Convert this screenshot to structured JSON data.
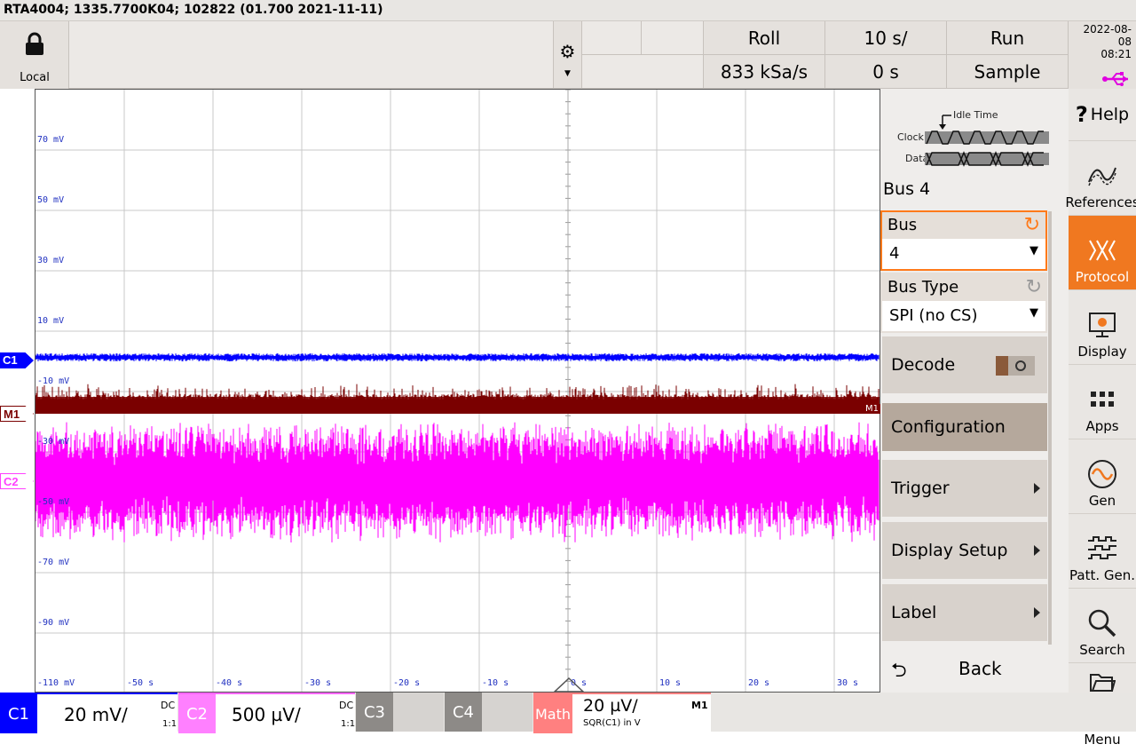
{
  "title_bar": "RTA4004; 1335.7700K04; 102822 (01.700 2021-11-11)",
  "header": {
    "lock_label": "Local",
    "acq_mode": "Roll",
    "timebase": "10 s/",
    "run_state": "Run",
    "sample_rate": "833 kSa/s",
    "offset": "0 s",
    "acq_type": "Sample",
    "date": "2022-08-08",
    "time": "08:21"
  },
  "plot": {
    "y_labels": [
      "70 mV",
      "50 mV",
      "30 mV",
      "10 mV",
      "-10 mV",
      "-30 mV",
      "-50 mV",
      "-70 mV",
      "-90 mV",
      "-110 mV"
    ],
    "x_labels": [
      "-50 s",
      "-40 s",
      "-30 s",
      "-20 s",
      "-10 s",
      "0 s",
      "10 s",
      "20 s",
      "30 s"
    ],
    "markers": {
      "c1": "C1",
      "m1": "M1",
      "c2": "C2",
      "m1_right": "M1"
    },
    "colors": {
      "c1": "#0000ff",
      "m1": "#7a0000",
      "c2": "#ff00ff"
    }
  },
  "panel": {
    "diagram": {
      "idle": "Idle Time",
      "clock": "Clock",
      "data": "Data"
    },
    "bus_title": "Bus 4",
    "bus_label": "Bus",
    "bus_value": "4",
    "bus_type_label": "Bus Type",
    "bus_type_value": "SPI (no CS)",
    "decode": "Decode",
    "configuration": "Configuration",
    "trigger": "Trigger",
    "display_setup": "Display Setup",
    "label": "Label",
    "back": "Back"
  },
  "sidebar": {
    "help": "Help",
    "references": "References",
    "protocol": "Protocol",
    "display": "Display",
    "apps": "Apps",
    "gen": "Gen",
    "patt_gen": "Patt. Gen.",
    "search": "Search",
    "menu": "Menu"
  },
  "bottom": {
    "c1_name": "C1",
    "c1_scale": "20 mV/",
    "c1_coupling": "DC",
    "c1_ratio": "1:1",
    "c2_name": "C2",
    "c2_scale": "500 µV/",
    "c2_coupling": "DC",
    "c2_ratio": "1:1",
    "c3_name": "C3",
    "c4_name": "C4",
    "math_name": "Math",
    "math_scale": "20 µV/",
    "math_expr": "SQR(C1) in V",
    "math_src": "M1"
  }
}
